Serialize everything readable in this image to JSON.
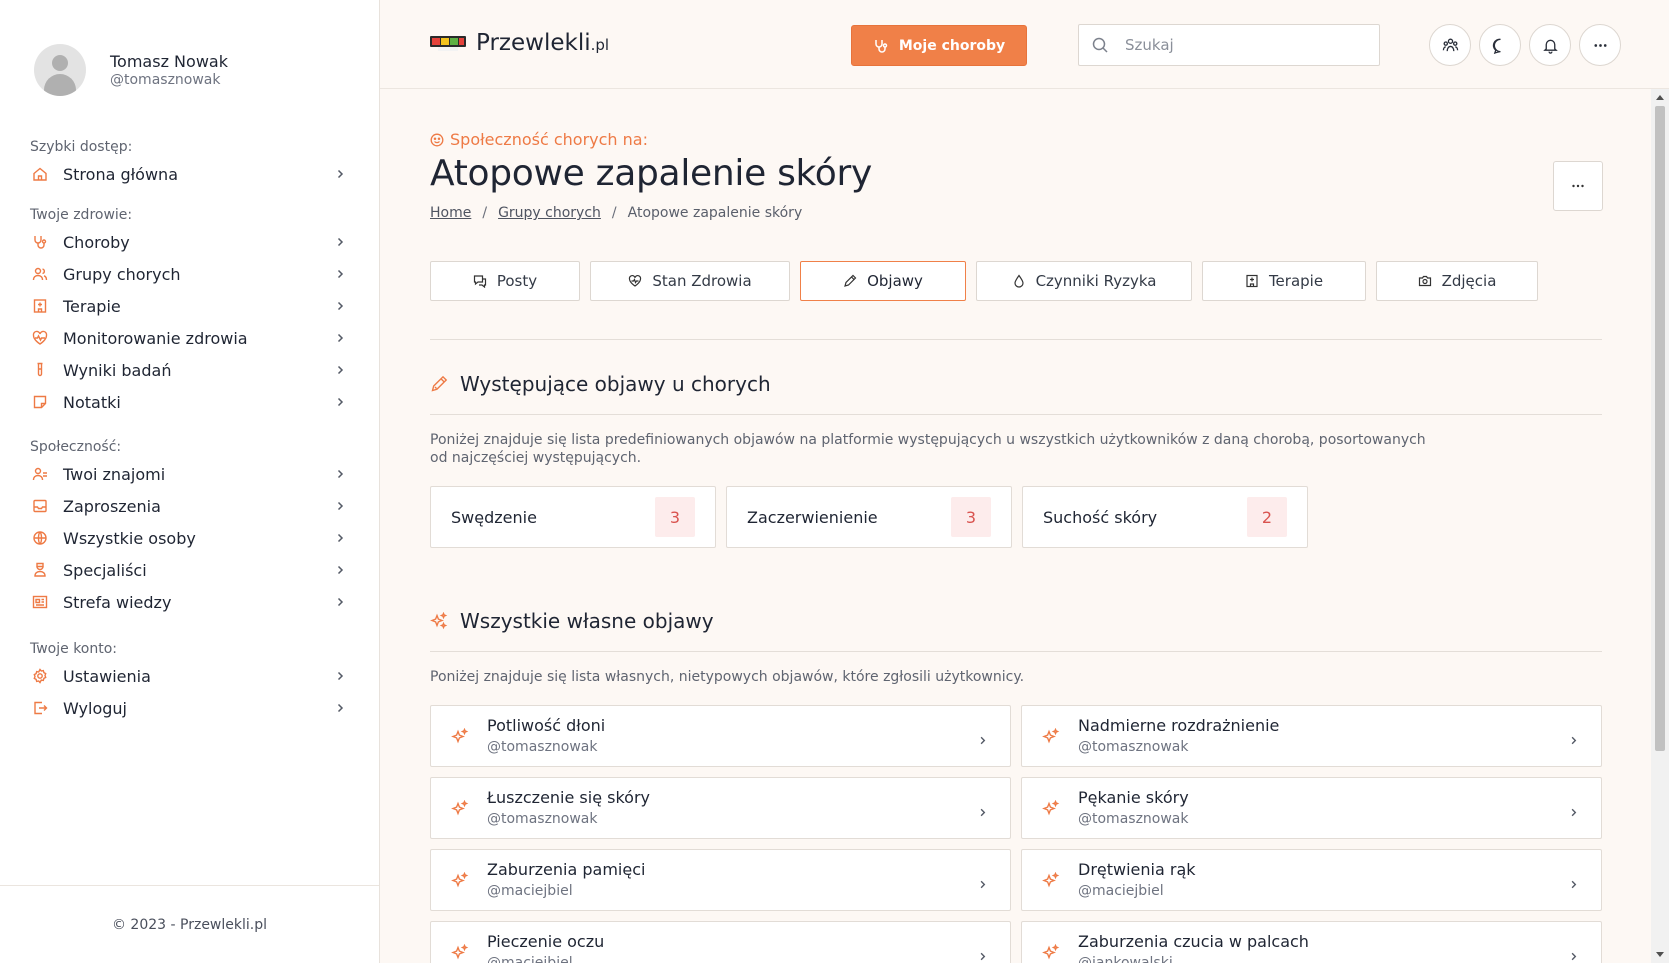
{
  "user": {
    "name": "Tomasz Nowak",
    "handle": "@tomasznowak"
  },
  "sidebar": {
    "sections": [
      {
        "label": "Szybki dostęp:",
        "items": [
          {
            "label": "Strona główna",
            "icon": "home-icon"
          }
        ]
      },
      {
        "label": "Twoje zdrowie:",
        "items": [
          {
            "label": "Choroby",
            "icon": "stethoscope-icon"
          },
          {
            "label": "Grupy chorych",
            "icon": "users-icon"
          },
          {
            "label": "Terapie",
            "icon": "hospital-icon"
          },
          {
            "label": "Monitorowanie zdrowia",
            "icon": "heart-pulse-icon"
          },
          {
            "label": "Wyniki badań",
            "icon": "test-tube-icon"
          },
          {
            "label": "Notatki",
            "icon": "note-icon"
          }
        ]
      },
      {
        "label": "Społeczność:",
        "items": [
          {
            "label": "Twoi znajomi",
            "icon": "friends-icon"
          },
          {
            "label": "Zaproszenia",
            "icon": "inbox-icon"
          },
          {
            "label": "Wszystkie osoby",
            "icon": "globe-icon"
          },
          {
            "label": "Specjaliści",
            "icon": "doctor-icon"
          },
          {
            "label": "Strefa wiedzy",
            "icon": "newspaper-icon"
          }
        ]
      },
      {
        "label": "Twoje konto:",
        "items": [
          {
            "label": "Ustawienia",
            "icon": "settings-icon"
          },
          {
            "label": "Wyloguj",
            "icon": "logout-icon"
          }
        ]
      }
    ],
    "footer": "© 2023 - Przewlekli.pl"
  },
  "header": {
    "logo_text": "Przewlekli",
    "logo_suffix": ".pl",
    "primary_button": "Moje choroby",
    "search_placeholder": "Szukaj",
    "icons": [
      "community-icon",
      "chat-icon",
      "bell-icon",
      "more-icon"
    ]
  },
  "page": {
    "community_label": "Społeczność chorych na:",
    "title": "Atopowe zapalenie skóry",
    "breadcrumb": [
      "Home",
      "Grupy chorych",
      "Atopowe zapalenie skóry"
    ]
  },
  "tabs": [
    {
      "label": "Posty",
      "icon": "chat-icon",
      "active": false
    },
    {
      "label": "Stan Zdrowia",
      "icon": "heart-icon",
      "active": false
    },
    {
      "label": "Objawy",
      "icon": "pencil-icon",
      "active": true
    },
    {
      "label": "Czynniki Ryzyka",
      "icon": "drop-icon",
      "active": false
    },
    {
      "label": "Terapie",
      "icon": "hospital-icon",
      "active": false
    },
    {
      "label": "Zdjęcia",
      "icon": "camera-icon",
      "active": false
    }
  ],
  "predefined": {
    "title": "Występujące objawy u chorych",
    "description": "Poniżej znajduje się lista predefiniowanych objawów na platformie występujących u wszystkich użytkowników z daną chorobą, posortowanych od najczęściej występujących.",
    "items": [
      {
        "name": "Swędzenie",
        "count": "3"
      },
      {
        "name": "Zaczerwienienie",
        "count": "3"
      },
      {
        "name": "Suchość skóry",
        "count": "2"
      }
    ]
  },
  "own": {
    "title": "Wszystkie własne objawy",
    "description": "Poniżej znajduje się lista własnych, nietypowych objawów, które zgłosili użytkownicy.",
    "items": [
      {
        "name": "Potliwość dłoni",
        "author": "@tomasznowak"
      },
      {
        "name": "Nadmierne rozdrażnienie",
        "author": "@tomasznowak"
      },
      {
        "name": "Łuszczenie się skóry",
        "author": "@tomasznowak"
      },
      {
        "name": "Pękanie skóry",
        "author": "@tomasznowak"
      },
      {
        "name": "Zaburzenia pamięci",
        "author": "@maciejbiel"
      },
      {
        "name": "Drętwienia rąk",
        "author": "@maciejbiel"
      },
      {
        "name": "Pieczenie oczu",
        "author": "@maciejbiel"
      },
      {
        "name": "Zaburzenia czucia w palcach",
        "author": "@jankowalski"
      }
    ]
  },
  "colors": {
    "accent": "#f08048",
    "badge_bg": "#fdecec",
    "badge_text": "#d9534f",
    "page_bg": "#fdf8f4"
  }
}
